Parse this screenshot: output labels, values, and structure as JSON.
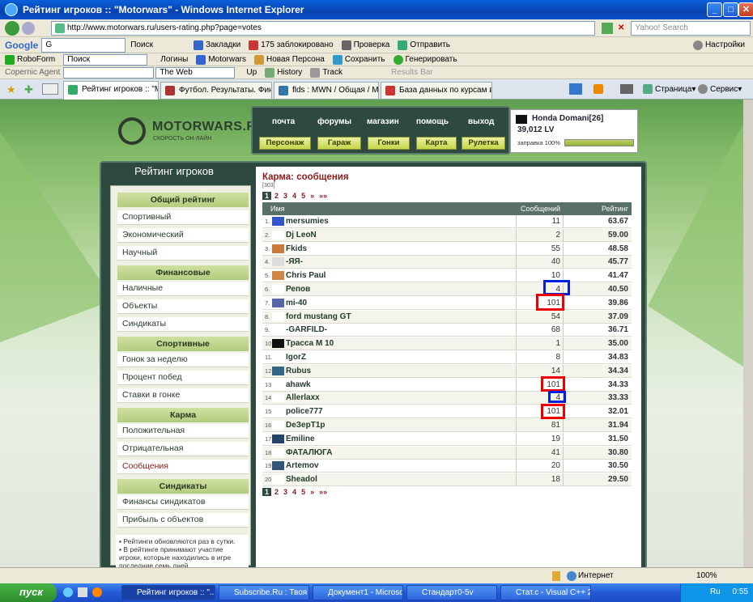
{
  "window": {
    "title": "Рейтинг игроков :: \"Motorwars\" - Windows Internet Explorer"
  },
  "address": {
    "url": "http://www.motorwars.ru/users-rating.php?page=votes",
    "search_placeholder": "Yahoo! Search"
  },
  "google_bar": {
    "brand": "Google",
    "input": "G",
    "search": "Поиск",
    "bookmarks": "Закладки",
    "blocked": "175 заблокировано",
    "check": "Проверка",
    "send": "Отправить",
    "settings": "Настройки"
  },
  "roboform_bar": {
    "brand": "RoboForm",
    "search": "Поиск",
    "logins": "Логины",
    "motorwars": "Motorwars",
    "new_persona": "Новая Персона",
    "save": "Сохранить",
    "generate": "Генерировать"
  },
  "copernic_bar": {
    "brand": "Copernic Agent",
    "scope": "The Web",
    "up": "Up",
    "history": "History",
    "track": "Track",
    "results": "Results Bar"
  },
  "tabs": [
    {
      "label": "Рейтинг игроков :: \"Mot..."
    },
    {
      "label": "Футбол. Результаты. Фина..."
    },
    {
      "label": "flds : MWN / Общая / MWN ..."
    },
    {
      "label": "База данных по курсам вал..."
    }
  ],
  "ie_toolbar": {
    "page": "Страница",
    "service": "Сервис"
  },
  "site": {
    "logo_text": "MOTORWARS.RU",
    "logo_sub": "СКОРОСТЬ ОН-ЛАЙН",
    "nav_top": [
      "почта",
      "форумы",
      "магазин",
      "помощь",
      "выход"
    ],
    "nav_bottom": [
      "Персонаж",
      "Гараж",
      "Гонки",
      "Карта",
      "Рулетка"
    ],
    "user": {
      "car": "Honda Domani[26]",
      "money": "39,012 LV",
      "fuel_label": "заправка 100%",
      "fuel": 1.0
    }
  },
  "sidebar": {
    "title": "Рейтинг игроков",
    "groups": [
      {
        "header": "Общий рейтинг",
        "items": [
          "Спортивный",
          "Экономический",
          "Научный"
        ]
      },
      {
        "header": "Финансовые",
        "items": [
          "Наличные",
          "Объекты",
          "Синдикаты"
        ]
      },
      {
        "header": "Спортивные",
        "items": [
          "Гонок за неделю",
          "Процент побед",
          "Ставки в гонке"
        ]
      },
      {
        "header": "Карма",
        "items": [
          "Положительная",
          "Отрицательная",
          "Сообщения"
        ]
      },
      {
        "header": "Синдикаты",
        "items": [
          "Финансы синдикатов",
          "Прибыль с объектов"
        ]
      }
    ],
    "note1": "Рейтинги обновляются раз в сутки.",
    "note2": "В рейтинге принимают участие игроки, которые находились в игре последние семь дней."
  },
  "main": {
    "title": "Карма: сообщения",
    "count": "[303]",
    "pager": [
      "1",
      "2",
      "3",
      "4",
      "5",
      "»",
      "»»"
    ],
    "headers": {
      "name": "Имя",
      "votes": "Сообщений",
      "rating": "Рейтинг"
    },
    "rows": [
      {
        "n": "1.",
        "name": "mersumies",
        "votes": "11",
        "rating": "63.67"
      },
      {
        "n": "2.",
        "name": "Dj LeoN",
        "votes": "2",
        "rating": "59.00"
      },
      {
        "n": "3.",
        "name": "Fkids",
        "votes": "55",
        "rating": "48.58"
      },
      {
        "n": "4.",
        "name": "-ЯЯ-",
        "votes": "40",
        "rating": "45.77"
      },
      {
        "n": "5.",
        "name": "Chris Paul",
        "votes": "10",
        "rating": "41.47"
      },
      {
        "n": "6.",
        "name": "Репов",
        "votes": "4",
        "rating": "40.50"
      },
      {
        "n": "7.",
        "name": "mi-40",
        "votes": "101",
        "rating": "39.86"
      },
      {
        "n": "8.",
        "name": "ford mustang GT",
        "votes": "54",
        "rating": "37.09"
      },
      {
        "n": "9.",
        "name": "-GARFILD-",
        "votes": "68",
        "rating": "36.71"
      },
      {
        "n": "10.",
        "name": "Трасса М 10",
        "votes": "1",
        "rating": "35.00"
      },
      {
        "n": "11.",
        "name": "IgorZ",
        "votes": "8",
        "rating": "34.83"
      },
      {
        "n": "12.",
        "name": "Rubus",
        "votes": "14",
        "rating": "34.34"
      },
      {
        "n": "13.",
        "name": "ahawk",
        "votes": "101",
        "rating": "34.33"
      },
      {
        "n": "14.",
        "name": "Allerlaxx",
        "votes": "4",
        "rating": "33.33"
      },
      {
        "n": "15.",
        "name": "police777",
        "votes": "101",
        "rating": "32.01"
      },
      {
        "n": "16.",
        "name": "DeЗерТ1р",
        "votes": "81",
        "rating": "31.94"
      },
      {
        "n": "17.",
        "name": "Emiline",
        "votes": "19",
        "rating": "31.50"
      },
      {
        "n": "18.",
        "name": "ФАТАЛЮГА",
        "votes": "41",
        "rating": "30.80"
      },
      {
        "n": "19.",
        "name": "Artemov",
        "votes": "20",
        "rating": "30.50"
      },
      {
        "n": "20.",
        "name": "Sheadol",
        "votes": "18",
        "rating": "29.50"
      }
    ],
    "avatar_colors": [
      "#3355cc",
      "#ffffff",
      "#c87a3a",
      "#dddddd",
      "#cc8844",
      "#ffffff",
      "#5566aa",
      "#ffffff",
      "#ffffff",
      "#111111",
      "#ffffff",
      "#336688",
      "#ffffff",
      "#ffffff",
      "#ffffff",
      "#ffffff",
      "#224466",
      "#ffffff",
      "#335577",
      "#ffffff"
    ]
  },
  "status": {
    "zone": "Интернет",
    "zoom": "100%"
  },
  "taskbar": {
    "start": "пуск",
    "tasks": [
      "Рейтинг игроков :: \"...",
      "Subscribe.Ru : Твоя ...",
      "Документ1 - Microso...",
      "Стандарт0-5v",
      "Стат.с - Visual C++ 2..."
    ],
    "lang": "Ru",
    "time": "0:55"
  }
}
